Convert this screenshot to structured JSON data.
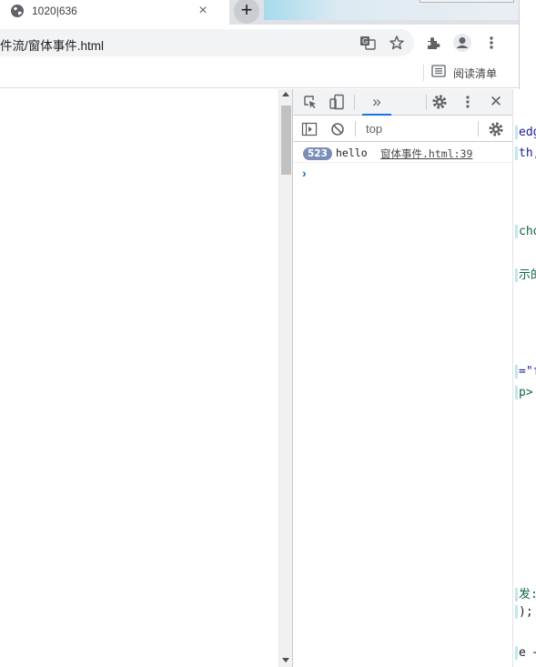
{
  "browser": {
    "tab_title": "1020|636",
    "tab_close_glyph": "×",
    "new_tab_glyph": "+",
    "url": "件流/窗体事件.html",
    "toolbar_icons": [
      "translate-icon",
      "star-icon",
      "extensions-icon",
      "profile-icon",
      "menu-icon"
    ],
    "reading_list_label": "阅读清单"
  },
  "devtools": {
    "more_tabs_glyph": "»",
    "close_glyph": "✕",
    "context": "top",
    "console": {
      "messages": [
        {
          "count": "523",
          "text": "hello",
          "source": "窗体事件.html:39"
        }
      ],
      "prompt_glyph": "›"
    }
  },
  "background_editor": {
    "lines": [
      "edg",
      "th,",
      "cho",
      "示的",
      "=\"f",
      "p>",
      "发:",
      ");",
      "e +"
    ],
    "colors": [
      "#1a1aa6",
      "#1a1aa6",
      "#116644",
      "#116644",
      "#1a1aa6",
      "#116644",
      "#116644",
      "#202124",
      "#202124"
    ]
  },
  "colors": {
    "accent": "#1a73e8",
    "badge": "#7b8db8",
    "tab_strip": "#dee1e6",
    "omnibox": "#f1f3f4"
  }
}
